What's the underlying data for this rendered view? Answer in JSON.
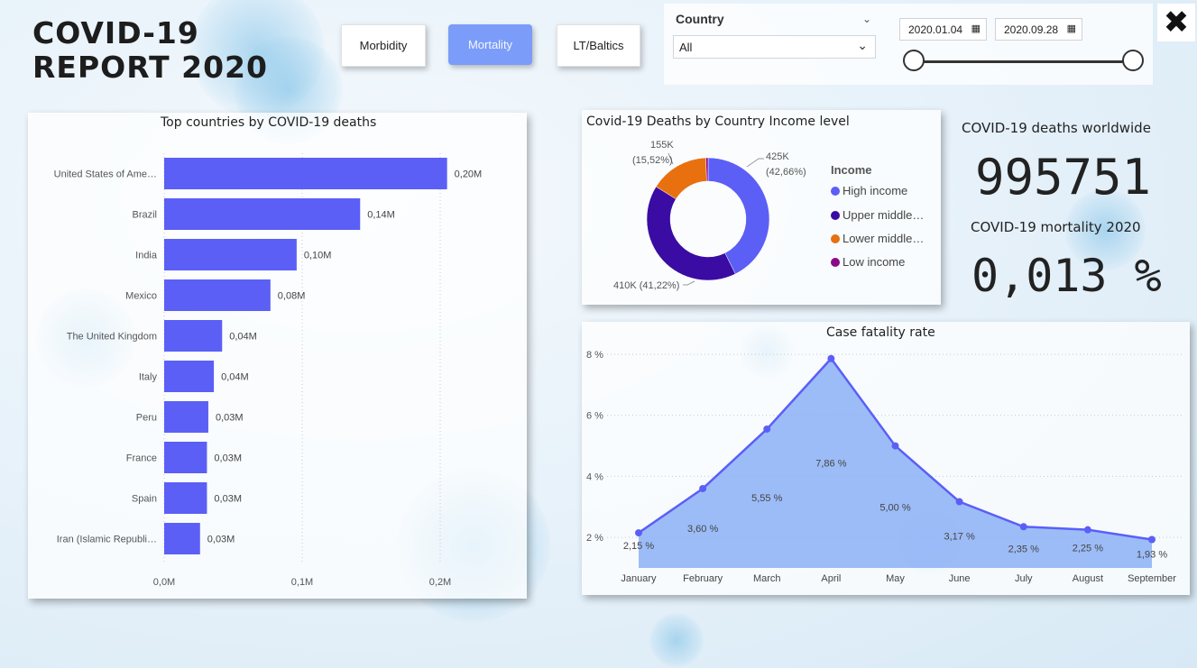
{
  "header": {
    "title_line1": "COVID-19",
    "title_line2": "REPORT 2020"
  },
  "nav": {
    "morbidity": "Morbidity",
    "mortality": "Mortality",
    "lt_baltics": "LT/Baltics"
  },
  "filters": {
    "country_label": "Country",
    "country_value": "All",
    "date_start": "2020.01.04",
    "date_end": "2020.09.28"
  },
  "kpis": {
    "deaths_label": "COVID-19 deaths worldwide",
    "deaths_value": "995751",
    "mortality_label": "COVID-19 mortality 2020",
    "mortality_value": "0,013 %"
  },
  "colors": {
    "bar": "#5b5ff6",
    "high_income": "#5b5ff6",
    "upper_middle": "#3a0ca3",
    "lower_middle": "#e8700f",
    "low_income": "#8a0a8c",
    "area_fill": "#8cb0f6",
    "line": "#5b5ff6",
    "active_button": "#7b9cf8"
  },
  "chart_data": [
    {
      "type": "bar",
      "title": "Top countries by COVID-19 deaths",
      "categories": [
        "United States of Ame…",
        "Brazil",
        "India",
        "Mexico",
        "The United Kingdom",
        "Italy",
        "Peru",
        "France",
        "Spain",
        "Iran (Islamic Republi…"
      ],
      "values": [
        0.2,
        0.14,
        0.1,
        0.08,
        0.04,
        0.04,
        0.03,
        0.03,
        0.03,
        0.03
      ],
      "value_labels": [
        "0,20M",
        "0,14M",
        "0,10M",
        "0,08M",
        "0,04M",
        "0,04M",
        "0,03M",
        "0,03M",
        "0,03M",
        "0,03M"
      ],
      "bar_values": [
        0.205,
        0.142,
        0.096,
        0.077,
        0.042,
        0.036,
        0.032,
        0.031,
        0.031,
        0.026
      ],
      "xlim": [
        0,
        0.25
      ],
      "xticks": [
        0,
        0.1,
        0.2
      ],
      "xtick_labels": [
        "0,0M",
        "0,1M",
        "0,2M"
      ]
    },
    {
      "type": "pie",
      "title": "Covid-19 Deaths by Country Income level",
      "legend_title": "Income",
      "legend": [
        "High income",
        "Upper middle…",
        "Lower middle…",
        "Low income"
      ],
      "values": [
        42.66,
        41.22,
        15.52,
        0.6
      ],
      "labels": [
        {
          "line1": "425K",
          "line2": "(42,66%)"
        },
        {
          "line1": "410K (41,22%)",
          "line2": ""
        },
        {
          "line1": "155K",
          "line2": "(15,52%)"
        }
      ]
    },
    {
      "type": "area",
      "title": "Case fatality rate",
      "categories": [
        "January",
        "February",
        "March",
        "April",
        "May",
        "June",
        "July",
        "August",
        "September"
      ],
      "values": [
        2.15,
        3.6,
        5.55,
        7.86,
        5.0,
        3.17,
        2.35,
        2.25,
        1.93
      ],
      "value_labels": [
        "2,15 %",
        "3,60 %",
        "5,55 %",
        "7,86 %",
        "5,00 %",
        "3,17 %",
        "2,35 %",
        "2,25 %",
        "1,93 %"
      ],
      "ylim": [
        1,
        8
      ],
      "yticks": [
        2,
        4,
        6,
        8
      ],
      "ytick_labels": [
        "2 %",
        "4 %",
        "6 %",
        "8 %"
      ],
      "grid": true
    }
  ]
}
